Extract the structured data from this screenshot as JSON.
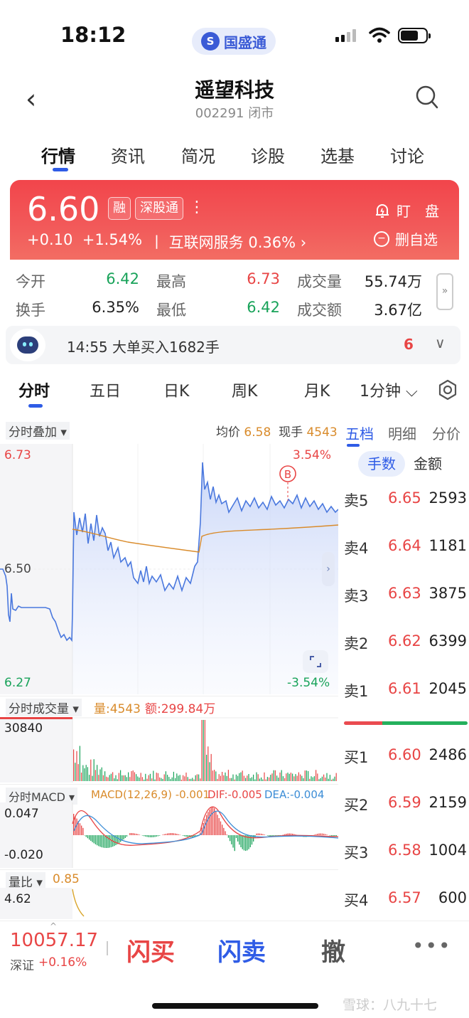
{
  "status": {
    "time": "18:12",
    "carrier": "国盛通",
    "carrier_logo": "S"
  },
  "header": {
    "back": "‹",
    "name": "遥望科技",
    "code_status": "002291 闭市"
  },
  "main_tabs": [
    {
      "label": "行情"
    },
    {
      "label": "资讯"
    },
    {
      "label": "简况"
    },
    {
      "label": "诊股"
    },
    {
      "label": "选基"
    },
    {
      "label": "讨论"
    }
  ],
  "quote": {
    "price": "6.60",
    "tag_margin": "融",
    "tag_connect": "深股通",
    "change": "+0.10",
    "change_pct": "+1.54%",
    "industry": "丨 互联网服务  0.36% ›",
    "watch": "盯　盘",
    "unfav": "删自选"
  },
  "stats": {
    "open_label": "今开",
    "open": "6.42",
    "high_label": "最高",
    "high": "6.73",
    "volume_label": "成交量",
    "volume": "55.74万",
    "turnover_label": "换手",
    "turnover": "6.35%",
    "low_label": "最低",
    "low": "6.42",
    "amount_label": "成交额",
    "amount": "3.67亿",
    "expand": "»"
  },
  "alert": {
    "text": "14:55 大单买入1682手",
    "count": "6",
    "chevron": "∨"
  },
  "chart_tabs": [
    {
      "label": "分时"
    },
    {
      "label": "五日"
    },
    {
      "label": "日K"
    },
    {
      "label": "周K"
    },
    {
      "label": "月K"
    },
    {
      "label": "1分钟 ⌵"
    }
  ],
  "intraday": {
    "overlay_label": "分时叠加 ▾",
    "avg_label": "均价",
    "avg_value": "6.58",
    "hand_label": "现手",
    "hand_value": "4543",
    "y_top": "6.73",
    "y_mid": "6.50",
    "y_bot": "6.27",
    "pct_top": "3.54%",
    "pct_bot": "-3.54%",
    "marker": "B"
  },
  "volume_panel": {
    "title": "分时成交量 ▾",
    "qty": "量:4543",
    "amt": "额:299.84万",
    "max": "30840"
  },
  "macd_panel": {
    "title": "分时MACD ▾",
    "macd": "MACD(12,26,9) -0.001",
    "dif": "DIF:-0.005",
    "dea": "DEA:-0.004",
    "top": "0.047",
    "bot": "-0.020"
  },
  "ratio_panel": {
    "title": "量比 ▾",
    "value": "0.85",
    "top": "4.62"
  },
  "order_tabs": [
    {
      "label": "五档"
    },
    {
      "label": "明细"
    },
    {
      "label": "分价"
    }
  ],
  "order_toggle": {
    "shares": "手数",
    "amount": "金额"
  },
  "asks": [
    {
      "label": "卖5",
      "price": "6.65",
      "vol": "2593"
    },
    {
      "label": "卖4",
      "price": "6.64",
      "vol": "1181"
    },
    {
      "label": "卖3",
      "price": "6.63",
      "vol": "3875"
    },
    {
      "label": "卖2",
      "price": "6.62",
      "vol": "6399"
    },
    {
      "label": "卖1",
      "price": "6.61",
      "vol": "2045"
    }
  ],
  "bids": [
    {
      "label": "买1",
      "price": "6.60",
      "vol": "2486"
    },
    {
      "label": "买2",
      "price": "6.59",
      "vol": "2159"
    },
    {
      "label": "买3",
      "price": "6.58",
      "vol": "1004"
    },
    {
      "label": "买4",
      "price": "6.57",
      "vol": "600"
    }
  ],
  "bottom": {
    "index_value": "10057.17",
    "index_name": "深证",
    "index_chg": "+0.16%",
    "flash_buy": "闪买",
    "flash_sell": "闪卖",
    "cancel": "撤",
    "more": "•••"
  },
  "watermark": "雪球：八九十七",
  "colors": {
    "up": "#e84545",
    "down": "#19a35a",
    "accent": "#2f5ce6",
    "avg_line": "#d98b2b"
  }
}
